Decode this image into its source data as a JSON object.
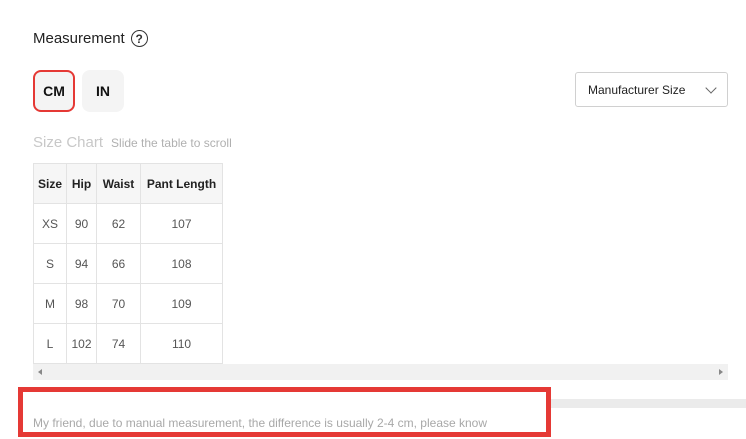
{
  "measurement": {
    "title": "Measurement",
    "help_icon": "?"
  },
  "units": {
    "cm": "CM",
    "in": "IN",
    "selected": "CM"
  },
  "size_select": {
    "value": "Manufacturer Size"
  },
  "chart": {
    "title": "Size Chart",
    "hint": "Slide the table to scroll"
  },
  "table": {
    "headers": [
      "Size",
      "Hip",
      "Waist",
      "Pant Length"
    ],
    "rows": [
      [
        "XS",
        "90",
        "62",
        "107"
      ],
      [
        "S",
        "94",
        "66",
        "108"
      ],
      [
        "M",
        "98",
        "70",
        "109"
      ],
      [
        "L",
        "102",
        "74",
        "110"
      ]
    ]
  },
  "notice": {
    "text": "My friend, due to manual measurement, the difference is usually 2-4 cm, please know"
  },
  "colors": {
    "accent": "#e53935"
  }
}
